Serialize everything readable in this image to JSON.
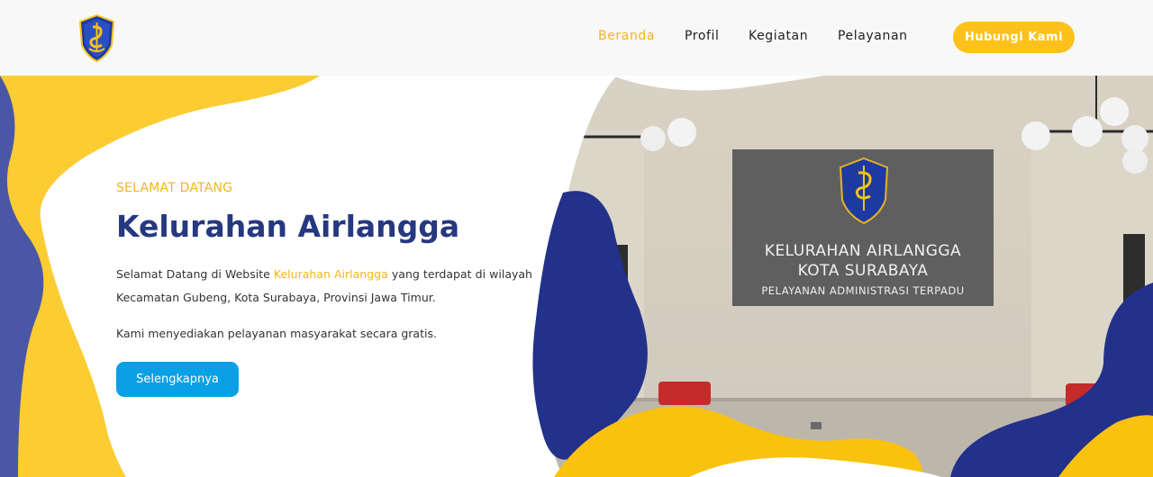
{
  "header": {
    "logo_name": "surabaya-crest-logo",
    "nav": [
      {
        "label": "Beranda",
        "active": true
      },
      {
        "label": "Profil",
        "active": false
      },
      {
        "label": "Kegiatan",
        "active": false
      },
      {
        "label": "Pelayanan",
        "active": false
      }
    ],
    "cta_label": "Hubungi Kami"
  },
  "hero": {
    "kicker": "SELAMAT DATANG",
    "title": "Kelurahan Airlangga",
    "desc_before": "Selamat Datang di Website ",
    "desc_highlight": "Kelurahan Airlangga",
    "desc_after": " yang terdapat di wilayah Kecamatan Gubeng, Kota Surabaya, Provinsi Jawa Timur.",
    "desc2": "Kami menyediakan pelayanan masyarakat secara gratis.",
    "button_label": "Selengkapnya"
  },
  "photo": {
    "sign_line1": "KELURAHAN AIRLANGGA",
    "sign_line2": "KOTA SURABAYA",
    "sign_line3": "PELAYANAN ADMINISTRASI TERPADU"
  },
  "colors": {
    "accent_yellow": "#fcc21b",
    "navy": "#253880",
    "shape_navy": "#24318a",
    "button_blue": "#0aa0e6"
  }
}
